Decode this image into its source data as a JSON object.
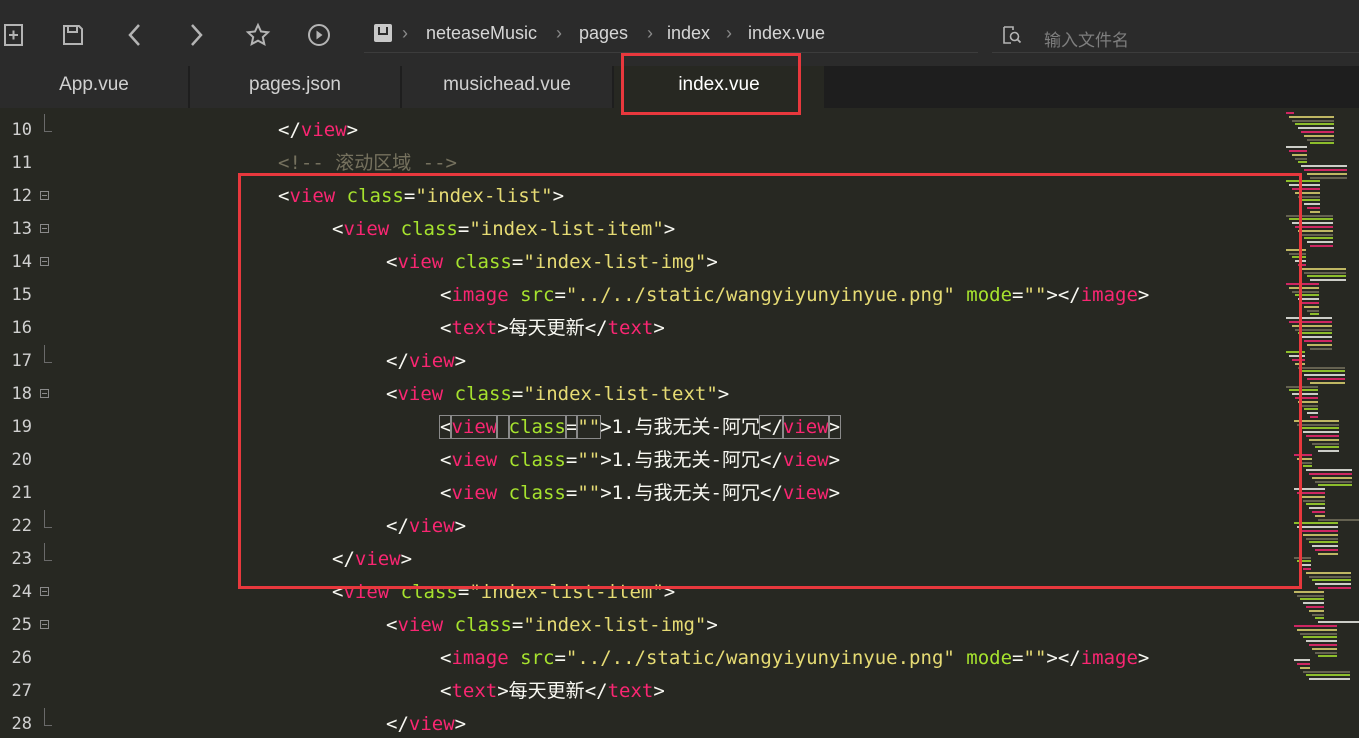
{
  "toolbar": {
    "icons": [
      "new-file-icon",
      "save-icon",
      "back-icon",
      "forward-icon",
      "star-icon",
      "run-icon"
    ]
  },
  "breadcrumb": {
    "project": "neteaseMusic",
    "folder": "pages",
    "subfolder": "index",
    "file": "index.vue",
    "separator": "›"
  },
  "search": {
    "placeholder": "输入文件名"
  },
  "tabs": [
    {
      "label": "App.vue",
      "active": false
    },
    {
      "label": "pages.json",
      "active": false
    },
    {
      "label": "musichead.vue",
      "active": false
    },
    {
      "label": "index.vue",
      "active": true
    }
  ],
  "colors": {
    "background": "#272822",
    "tag": "#f92672",
    "attr": "#a6e22e",
    "string": "#e6db74",
    "comment": "#75715e",
    "highlight": "#e8383d"
  },
  "editor": {
    "lines": [
      {
        "n": "10",
        "fold": "end",
        "indent": 5,
        "tokens": [
          [
            "pn",
            "</"
          ],
          [
            "tg",
            "view"
          ],
          [
            "pn",
            ">"
          ]
        ]
      },
      {
        "n": "11",
        "fold": "",
        "indent": 5,
        "tokens": [
          [
            "cm",
            "<!-- 滚动区域 -->"
          ]
        ]
      },
      {
        "n": "12",
        "fold": "open",
        "indent": 5,
        "tokens": [
          [
            "pn",
            "<"
          ],
          [
            "tg",
            "view"
          ],
          [
            "pn",
            " "
          ],
          [
            "at",
            "class"
          ],
          [
            "pn",
            "="
          ],
          [
            "st",
            "\"index-list\""
          ],
          [
            "pn",
            ">"
          ]
        ]
      },
      {
        "n": "13",
        "fold": "open",
        "indent": 6,
        "tokens": [
          [
            "pn",
            "<"
          ],
          [
            "tg",
            "view"
          ],
          [
            "pn",
            " "
          ],
          [
            "at",
            "class"
          ],
          [
            "pn",
            "="
          ],
          [
            "st",
            "\"index-list-item\""
          ],
          [
            "pn",
            ">"
          ]
        ]
      },
      {
        "n": "14",
        "fold": "open",
        "indent": 7,
        "tokens": [
          [
            "pn",
            "<"
          ],
          [
            "tg",
            "view"
          ],
          [
            "pn",
            " "
          ],
          [
            "at",
            "class"
          ],
          [
            "pn",
            "="
          ],
          [
            "st",
            "\"index-list-img\""
          ],
          [
            "pn",
            ">"
          ]
        ]
      },
      {
        "n": "15",
        "fold": "",
        "indent": 8,
        "tokens": [
          [
            "pn",
            "<"
          ],
          [
            "tg",
            "image"
          ],
          [
            "pn",
            " "
          ],
          [
            "at",
            "src"
          ],
          [
            "pn",
            "="
          ],
          [
            "st",
            "\"../../static/wangyiyunyinyue.png\""
          ],
          [
            "pn",
            " "
          ],
          [
            "at",
            "mode"
          ],
          [
            "pn",
            "="
          ],
          [
            "st",
            "\"\""
          ],
          [
            "pn",
            "></"
          ],
          [
            "tg",
            "image"
          ],
          [
            "pn",
            ">"
          ]
        ]
      },
      {
        "n": "16",
        "fold": "",
        "indent": 8,
        "tokens": [
          [
            "pn",
            "<"
          ],
          [
            "tg",
            "text"
          ],
          [
            "pn",
            ">"
          ],
          [
            "tx",
            "每天更新"
          ],
          [
            "pn",
            "</"
          ],
          [
            "tg",
            "text"
          ],
          [
            "pn",
            ">"
          ]
        ]
      },
      {
        "n": "17",
        "fold": "end",
        "indent": 7,
        "tokens": [
          [
            "pn",
            "</"
          ],
          [
            "tg",
            "view"
          ],
          [
            "pn",
            ">"
          ]
        ]
      },
      {
        "n": "18",
        "fold": "open",
        "indent": 7,
        "tokens": [
          [
            "pn",
            "<"
          ],
          [
            "tg",
            "view"
          ],
          [
            "pn",
            " "
          ],
          [
            "at",
            "class"
          ],
          [
            "pn",
            "="
          ],
          [
            "st",
            "\"index-list-text\""
          ],
          [
            "pn",
            ">"
          ]
        ]
      },
      {
        "n": "19",
        "fold": "",
        "indent": 8,
        "tokens": [
          [
            "pn",
            "<"
          ],
          [
            "tg",
            "view"
          ],
          [
            "pn",
            " "
          ],
          [
            "at",
            "class"
          ],
          [
            "pn",
            "="
          ],
          [
            "st",
            "\"\""
          ],
          [
            "pn",
            ">"
          ],
          [
            "tx",
            "1.与我无关-阿冗"
          ],
          [
            "pn",
            "</"
          ],
          [
            "tg",
            "view"
          ],
          [
            "pn",
            ">"
          ]
        ]
      },
      {
        "n": "20",
        "fold": "",
        "indent": 8,
        "tokens": [
          [
            "pn",
            "<"
          ],
          [
            "tg",
            "view"
          ],
          [
            "pn",
            " "
          ],
          [
            "at",
            "class"
          ],
          [
            "pn",
            "="
          ],
          [
            "st",
            "\"\""
          ],
          [
            "pn",
            ">"
          ],
          [
            "tx",
            "1.与我无关-阿冗"
          ],
          [
            "pn",
            "</"
          ],
          [
            "tg",
            "view"
          ],
          [
            "pn",
            ">"
          ]
        ]
      },
      {
        "n": "21",
        "fold": "",
        "indent": 8,
        "tokens": [
          [
            "pn",
            "<"
          ],
          [
            "tg",
            "view"
          ],
          [
            "pn",
            " "
          ],
          [
            "at",
            "class"
          ],
          [
            "pn",
            "="
          ],
          [
            "st",
            "\"\""
          ],
          [
            "pn",
            ">"
          ],
          [
            "tx",
            "1.与我无关-阿冗"
          ],
          [
            "pn",
            "</"
          ],
          [
            "tg",
            "view"
          ],
          [
            "pn",
            ">"
          ]
        ]
      },
      {
        "n": "22",
        "fold": "end",
        "indent": 7,
        "tokens": [
          [
            "pn",
            "</"
          ],
          [
            "tg",
            "view"
          ],
          [
            "pn",
            ">"
          ]
        ]
      },
      {
        "n": "23",
        "fold": "end",
        "indent": 6,
        "tokens": [
          [
            "pn",
            "</"
          ],
          [
            "tg",
            "view"
          ],
          [
            "pn",
            ">"
          ]
        ]
      },
      {
        "n": "24",
        "fold": "open",
        "indent": 6,
        "tokens": [
          [
            "pn",
            "<"
          ],
          [
            "tg",
            "view"
          ],
          [
            "pn",
            " "
          ],
          [
            "at",
            "class"
          ],
          [
            "pn",
            "="
          ],
          [
            "st",
            "\"index-list-item\""
          ],
          [
            "pn",
            ">"
          ]
        ]
      },
      {
        "n": "25",
        "fold": "open",
        "indent": 7,
        "tokens": [
          [
            "pn",
            "<"
          ],
          [
            "tg",
            "view"
          ],
          [
            "pn",
            " "
          ],
          [
            "at",
            "class"
          ],
          [
            "pn",
            "="
          ],
          [
            "st",
            "\"index-list-img\""
          ],
          [
            "pn",
            ">"
          ]
        ]
      },
      {
        "n": "26",
        "fold": "",
        "indent": 8,
        "tokens": [
          [
            "pn",
            "<"
          ],
          [
            "tg",
            "image"
          ],
          [
            "pn",
            " "
          ],
          [
            "at",
            "src"
          ],
          [
            "pn",
            "="
          ],
          [
            "st",
            "\"../../static/wangyiyunyinyue.png\""
          ],
          [
            "pn",
            " "
          ],
          [
            "at",
            "mode"
          ],
          [
            "pn",
            "="
          ],
          [
            "st",
            "\"\""
          ],
          [
            "pn",
            "></"
          ],
          [
            "tg",
            "image"
          ],
          [
            "pn",
            ">"
          ]
        ]
      },
      {
        "n": "27",
        "fold": "",
        "indent": 8,
        "tokens": [
          [
            "pn",
            "<"
          ],
          [
            "tg",
            "text"
          ],
          [
            "pn",
            ">"
          ],
          [
            "tx",
            "每天更新"
          ],
          [
            "pn",
            "</"
          ],
          [
            "tg",
            "text"
          ],
          [
            "pn",
            ">"
          ]
        ]
      },
      {
        "n": "28",
        "fold": "end",
        "indent": 7,
        "tokens": [
          [
            "pn",
            "</"
          ],
          [
            "tg",
            "view"
          ],
          [
            "pn",
            ">"
          ]
        ]
      }
    ]
  }
}
